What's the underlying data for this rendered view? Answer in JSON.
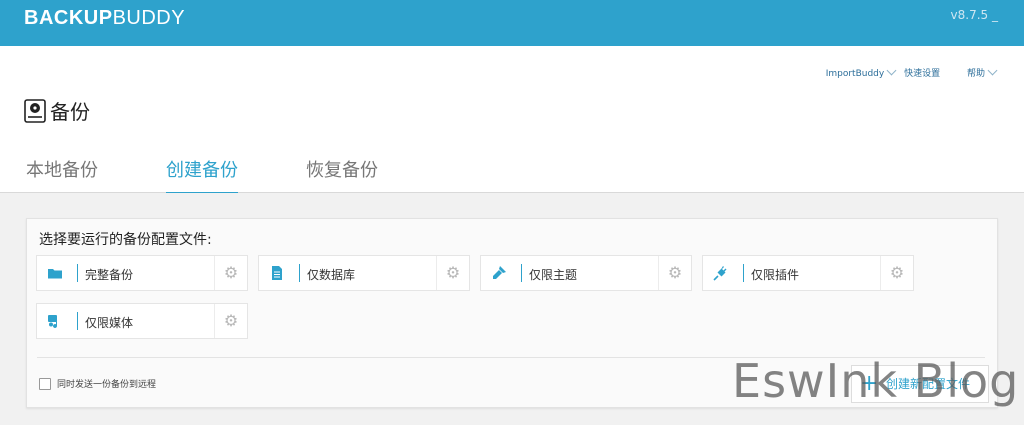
{
  "app": {
    "brand_bold": "BACKUP",
    "brand_light": "BUDDY",
    "version": "v8.7.5 _"
  },
  "header_links": {
    "importbuddy": "ImportBuddy",
    "quick_setup": "快速设置",
    "help": "帮助"
  },
  "page": {
    "title": "备份"
  },
  "tabs": [
    {
      "label": "本地备份",
      "active": false
    },
    {
      "label": "创建备份",
      "active": true
    },
    {
      "label": "恢复备份",
      "active": false
    }
  ],
  "panel": {
    "title": "选择要运行的备份配置文件:",
    "profiles": [
      {
        "label": "完整备份",
        "icon": "folder-icon"
      },
      {
        "label": "仅数据库",
        "icon": "database-file-icon"
      },
      {
        "label": "仅限主题",
        "icon": "brush-icon"
      },
      {
        "label": "仅限插件",
        "icon": "plugin-icon"
      },
      {
        "label": "仅限媒体",
        "icon": "media-icon"
      }
    ],
    "send_remote_label": "同时发送一份备份到远程",
    "create_profile_label": "创建新配置文件"
  },
  "watermark": "EswInk Blog",
  "colors": {
    "accent": "#2ea2cc",
    "topbar": "#2ea2cc"
  }
}
